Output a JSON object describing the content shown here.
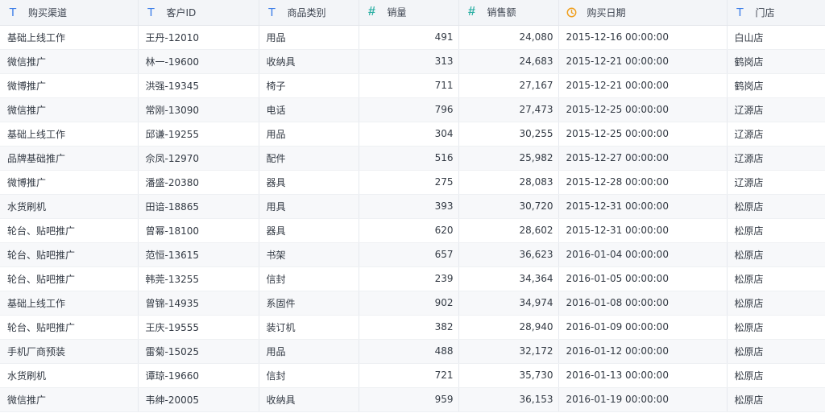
{
  "columns": [
    {
      "label": "购买渠道",
      "type": "text",
      "icon": "text-type-icon"
    },
    {
      "label": "客户ID",
      "type": "text",
      "icon": "text-type-icon"
    },
    {
      "label": "商品类别",
      "type": "text",
      "icon": "text-type-icon"
    },
    {
      "label": "销量",
      "type": "number",
      "icon": "number-type-icon"
    },
    {
      "label": "销售额",
      "type": "number",
      "icon": "number-type-icon"
    },
    {
      "label": "购买日期",
      "type": "date",
      "icon": "date-type-icon"
    },
    {
      "label": "门店",
      "type": "text",
      "icon": "text-type-icon"
    }
  ],
  "rows": [
    [
      "基础上线工作",
      "王丹-12010",
      "用品",
      "491",
      "24,080",
      "2015-12-16 00:00:00",
      "白山店"
    ],
    [
      "微信推广",
      "林一-19600",
      "收纳具",
      "313",
      "24,683",
      "2015-12-21 00:00:00",
      "鹤岗店"
    ],
    [
      "微博推广",
      "洪强-19345",
      "椅子",
      "711",
      "27,167",
      "2015-12-21 00:00:00",
      "鹤岗店"
    ],
    [
      "微信推广",
      "常刚-13090",
      "电话",
      "796",
      "27,473",
      "2015-12-25 00:00:00",
      "辽源店"
    ],
    [
      "基础上线工作",
      "邱谦-19255",
      "用品",
      "304",
      "30,255",
      "2015-12-25 00:00:00",
      "辽源店"
    ],
    [
      "品牌基础推广",
      "佘凤-12970",
      "配件",
      "516",
      "25,982",
      "2015-12-27 00:00:00",
      "辽源店"
    ],
    [
      "微博推广",
      "潘盛-20380",
      "器具",
      "275",
      "28,083",
      "2015-12-28 00:00:00",
      "辽源店"
    ],
    [
      "水货刷机",
      "田谙-18865",
      "用具",
      "393",
      "30,720",
      "2015-12-31 00:00:00",
      "松原店"
    ],
    [
      "轮台、贴吧推广",
      "曾幂-18100",
      "器具",
      "620",
      "28,602",
      "2015-12-31 00:00:00",
      "松原店"
    ],
    [
      "轮台、贴吧推广",
      "范恒-13615",
      "书架",
      "657",
      "36,623",
      "2016-01-04 00:00:00",
      "松原店"
    ],
    [
      "轮台、贴吧推广",
      "韩莞-13255",
      "信封",
      "239",
      "34,364",
      "2016-01-05 00:00:00",
      "松原店"
    ],
    [
      "基础上线工作",
      "曾锦-14935",
      "系固件",
      "902",
      "34,974",
      "2016-01-08 00:00:00",
      "松原店"
    ],
    [
      "轮台、贴吧推广",
      "王庆-19555",
      "装订机",
      "382",
      "28,940",
      "2016-01-09 00:00:00",
      "松原店"
    ],
    [
      "手机厂商预装",
      "雷菊-15025",
      "用品",
      "488",
      "32,172",
      "2016-01-12 00:00:00",
      "松原店"
    ],
    [
      "水货刷机",
      "谭琼-19660",
      "信封",
      "721",
      "35,730",
      "2016-01-13 00:00:00",
      "松原店"
    ],
    [
      "微信推广",
      "韦绅-20005",
      "收纳具",
      "959",
      "36,153",
      "2016-01-19 00:00:00",
      "松原店"
    ]
  ],
  "colors": {
    "text_icon": "#3e7fe8",
    "number_icon": "#2fb0a5",
    "date_icon": "#f0a020",
    "header_bg": "#f3f5f8",
    "stripe_bg": "#f7f8fa"
  }
}
